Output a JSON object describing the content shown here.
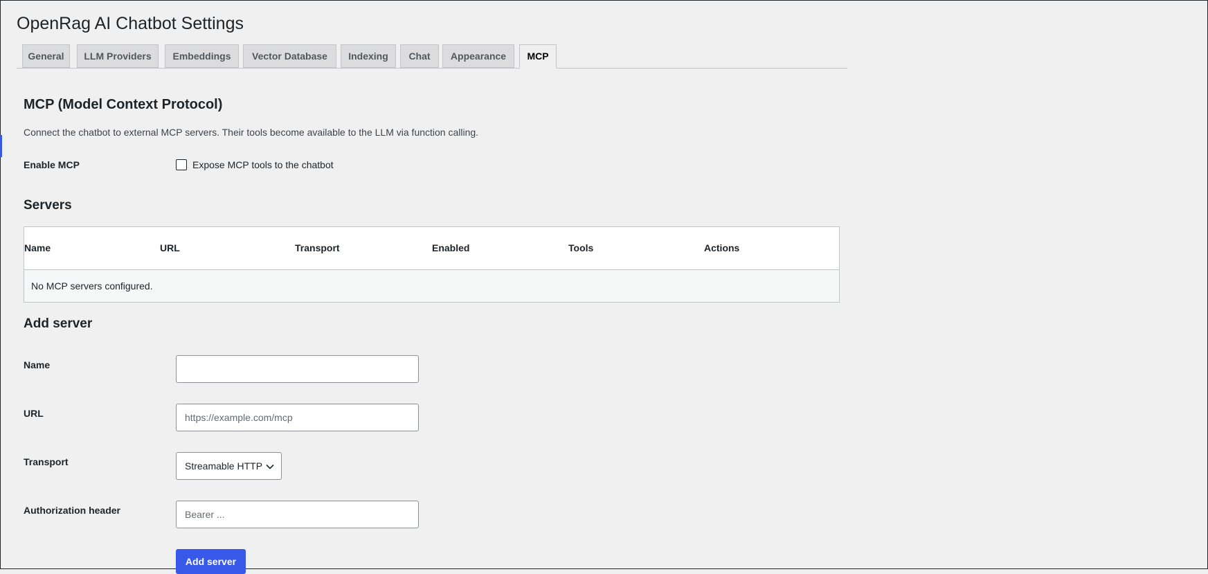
{
  "page": {
    "title": "OpenRag AI Chatbot Settings"
  },
  "tabs": [
    {
      "label": "General",
      "active": false
    },
    {
      "label": "LLM Providers",
      "active": false
    },
    {
      "label": "Embeddings",
      "active": false
    },
    {
      "label": "Vector Database",
      "active": false
    },
    {
      "label": "Indexing",
      "active": false
    },
    {
      "label": "Chat",
      "active": false
    },
    {
      "label": "Appearance",
      "active": false
    },
    {
      "label": "MCP",
      "active": true
    }
  ],
  "mcp": {
    "heading": "MCP (Model Context Protocol)",
    "description": "Connect the chatbot to external MCP servers. Their tools become available to the LLM via function calling.",
    "enable_label": "Enable MCP",
    "enable_checkbox_label": "Expose MCP tools to the chatbot",
    "enable_checked": false
  },
  "servers": {
    "heading": "Servers",
    "columns": [
      "Name",
      "URL",
      "Transport",
      "Enabled",
      "Tools",
      "Actions"
    ],
    "rows": [],
    "empty_text": "No MCP servers configured."
  },
  "add_server": {
    "heading": "Add server",
    "name_label": "Name",
    "name_value": "",
    "url_label": "URL",
    "url_value": "",
    "url_placeholder": "https://example.com/mcp",
    "transport_label": "Transport",
    "transport_value": "Streamable HTTP",
    "auth_label": "Authorization header",
    "auth_value": "",
    "auth_placeholder": "Bearer ...",
    "submit_label": "Add server"
  },
  "colors": {
    "accent": "#3858e9",
    "background": "#f0f0f1",
    "text": "#1d2327"
  },
  "icons": {
    "select_chevron": "chevron-down-icon"
  }
}
